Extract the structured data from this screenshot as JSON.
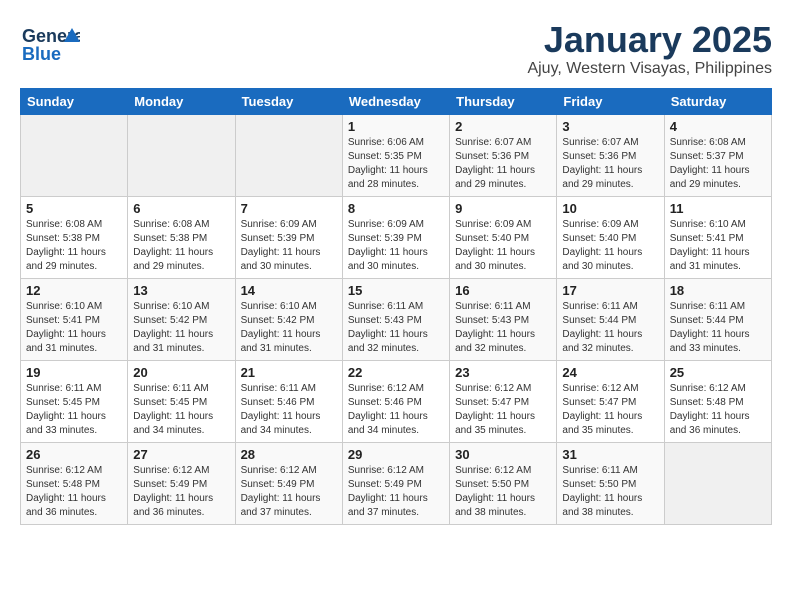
{
  "header": {
    "logo_line1": "General",
    "logo_line2": "Blue",
    "title": "January 2025",
    "subtitle": "Ajuy, Western Visayas, Philippines"
  },
  "calendar": {
    "days_of_week": [
      "Sunday",
      "Monday",
      "Tuesday",
      "Wednesday",
      "Thursday",
      "Friday",
      "Saturday"
    ],
    "weeks": [
      [
        {
          "day": "",
          "info": ""
        },
        {
          "day": "",
          "info": ""
        },
        {
          "day": "",
          "info": ""
        },
        {
          "day": "1",
          "info": "Sunrise: 6:06 AM\nSunset: 5:35 PM\nDaylight: 11 hours\nand 28 minutes."
        },
        {
          "day": "2",
          "info": "Sunrise: 6:07 AM\nSunset: 5:36 PM\nDaylight: 11 hours\nand 29 minutes."
        },
        {
          "day": "3",
          "info": "Sunrise: 6:07 AM\nSunset: 5:36 PM\nDaylight: 11 hours\nand 29 minutes."
        },
        {
          "day": "4",
          "info": "Sunrise: 6:08 AM\nSunset: 5:37 PM\nDaylight: 11 hours\nand 29 minutes."
        }
      ],
      [
        {
          "day": "5",
          "info": "Sunrise: 6:08 AM\nSunset: 5:38 PM\nDaylight: 11 hours\nand 29 minutes."
        },
        {
          "day": "6",
          "info": "Sunrise: 6:08 AM\nSunset: 5:38 PM\nDaylight: 11 hours\nand 29 minutes."
        },
        {
          "day": "7",
          "info": "Sunrise: 6:09 AM\nSunset: 5:39 PM\nDaylight: 11 hours\nand 30 minutes."
        },
        {
          "day": "8",
          "info": "Sunrise: 6:09 AM\nSunset: 5:39 PM\nDaylight: 11 hours\nand 30 minutes."
        },
        {
          "day": "9",
          "info": "Sunrise: 6:09 AM\nSunset: 5:40 PM\nDaylight: 11 hours\nand 30 minutes."
        },
        {
          "day": "10",
          "info": "Sunrise: 6:09 AM\nSunset: 5:40 PM\nDaylight: 11 hours\nand 30 minutes."
        },
        {
          "day": "11",
          "info": "Sunrise: 6:10 AM\nSunset: 5:41 PM\nDaylight: 11 hours\nand 31 minutes."
        }
      ],
      [
        {
          "day": "12",
          "info": "Sunrise: 6:10 AM\nSunset: 5:41 PM\nDaylight: 11 hours\nand 31 minutes."
        },
        {
          "day": "13",
          "info": "Sunrise: 6:10 AM\nSunset: 5:42 PM\nDaylight: 11 hours\nand 31 minutes."
        },
        {
          "day": "14",
          "info": "Sunrise: 6:10 AM\nSunset: 5:42 PM\nDaylight: 11 hours\nand 31 minutes."
        },
        {
          "day": "15",
          "info": "Sunrise: 6:11 AM\nSunset: 5:43 PM\nDaylight: 11 hours\nand 32 minutes."
        },
        {
          "day": "16",
          "info": "Sunrise: 6:11 AM\nSunset: 5:43 PM\nDaylight: 11 hours\nand 32 minutes."
        },
        {
          "day": "17",
          "info": "Sunrise: 6:11 AM\nSunset: 5:44 PM\nDaylight: 11 hours\nand 32 minutes."
        },
        {
          "day": "18",
          "info": "Sunrise: 6:11 AM\nSunset: 5:44 PM\nDaylight: 11 hours\nand 33 minutes."
        }
      ],
      [
        {
          "day": "19",
          "info": "Sunrise: 6:11 AM\nSunset: 5:45 PM\nDaylight: 11 hours\nand 33 minutes."
        },
        {
          "day": "20",
          "info": "Sunrise: 6:11 AM\nSunset: 5:45 PM\nDaylight: 11 hours\nand 34 minutes."
        },
        {
          "day": "21",
          "info": "Sunrise: 6:11 AM\nSunset: 5:46 PM\nDaylight: 11 hours\nand 34 minutes."
        },
        {
          "day": "22",
          "info": "Sunrise: 6:12 AM\nSunset: 5:46 PM\nDaylight: 11 hours\nand 34 minutes."
        },
        {
          "day": "23",
          "info": "Sunrise: 6:12 AM\nSunset: 5:47 PM\nDaylight: 11 hours\nand 35 minutes."
        },
        {
          "day": "24",
          "info": "Sunrise: 6:12 AM\nSunset: 5:47 PM\nDaylight: 11 hours\nand 35 minutes."
        },
        {
          "day": "25",
          "info": "Sunrise: 6:12 AM\nSunset: 5:48 PM\nDaylight: 11 hours\nand 36 minutes."
        }
      ],
      [
        {
          "day": "26",
          "info": "Sunrise: 6:12 AM\nSunset: 5:48 PM\nDaylight: 11 hours\nand 36 minutes."
        },
        {
          "day": "27",
          "info": "Sunrise: 6:12 AM\nSunset: 5:49 PM\nDaylight: 11 hours\nand 36 minutes."
        },
        {
          "day": "28",
          "info": "Sunrise: 6:12 AM\nSunset: 5:49 PM\nDaylight: 11 hours\nand 37 minutes."
        },
        {
          "day": "29",
          "info": "Sunrise: 6:12 AM\nSunset: 5:49 PM\nDaylight: 11 hours\nand 37 minutes."
        },
        {
          "day": "30",
          "info": "Sunrise: 6:12 AM\nSunset: 5:50 PM\nDaylight: 11 hours\nand 38 minutes."
        },
        {
          "day": "31",
          "info": "Sunrise: 6:11 AM\nSunset: 5:50 PM\nDaylight: 11 hours\nand 38 minutes."
        },
        {
          "day": "",
          "info": ""
        }
      ]
    ]
  }
}
